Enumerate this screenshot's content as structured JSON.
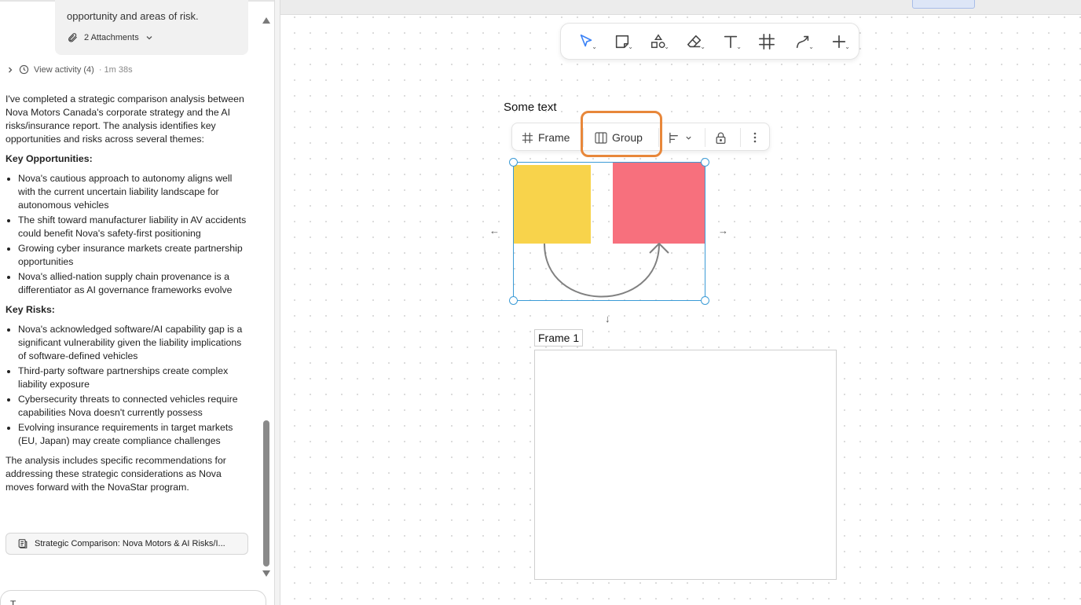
{
  "chat": {
    "attachment_text": "opportunity and areas of risk.",
    "attachments_label": "2 Attachments",
    "activity_label": "View activity (4)",
    "activity_time": "· 1m 38s",
    "intro": "I've completed a strategic comparison analysis between Nova Motors Canada's corporate strategy and the AI risks/insurance report. The analysis identifies key opportunities and risks across several themes:",
    "opportunities_heading": "Key Opportunities:",
    "opportunities": [
      "Nova's cautious approach to autonomy aligns well with the current uncertain liability landscape for autonomous vehicles",
      "The shift toward manufacturer liability in AV accidents could benefit Nova's safety-first positioning",
      "Growing cyber insurance markets create partnership opportunities",
      "Nova's allied-nation supply chain provenance is a differentiator as AI governance frameworks evolve"
    ],
    "risks_heading": "Key Risks:",
    "risks": [
      "Nova's acknowledged software/AI capability gap is a significant vulnerability given the liability implications of software-defined vehicles",
      "Third-party software partnerships create complex liability exposure",
      "Cybersecurity threats to connected vehicles require capabilities Nova doesn't currently possess",
      "Evolving insurance requirements in target markets (EU, Japan) may create compliance challenges"
    ],
    "conclusion": "The analysis includes specific recommendations for addressing these strategic considerations as Nova moves forward with the NovaStar program.",
    "artifact_label": "Strategic Comparison: Nova Motors & AI Risks/I...",
    "input_placeholder": "T"
  },
  "canvas": {
    "some_text": "Some text",
    "selection_toolbar": {
      "frame_label": "Frame",
      "group_label": "Group"
    },
    "frame_name": "Frame 1",
    "tools": [
      "select-tool",
      "sticky-note-tool",
      "shapes-tool",
      "eraser-tool",
      "text-tool",
      "frame-tool",
      "connector-tool",
      "add-tool"
    ],
    "colors": {
      "sticky_yellow": "#f8d34b",
      "sticky_red": "#f7707d",
      "selection": "#3b9bd6",
      "highlight": "#e8873a",
      "accent": "#3b82f6"
    }
  }
}
